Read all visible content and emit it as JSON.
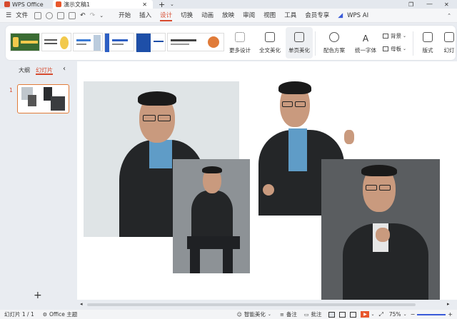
{
  "title_bar": {
    "app_tab": "WPS Office",
    "doc_tab": "演示文稿1",
    "new_tab": "+"
  },
  "menu": {
    "file": "文件",
    "items": [
      "开始",
      "插入",
      "设计",
      "切换",
      "动画",
      "放映",
      "审阅",
      "视图",
      "工具",
      "会员专享"
    ],
    "active": "设计",
    "ai": "WPS AI",
    "accent": "#d64a2e"
  },
  "ribbon": {
    "more_design": "更多设计",
    "full_beautify": "全文美化",
    "single_beautify": "单页美化",
    "color_scheme": "配色方案",
    "unify_font": "统一字体",
    "background": "背景",
    "master": "母板",
    "format": "版式",
    "more": "幻灯"
  },
  "left_panel": {
    "tab_outline": "大纲",
    "tab_slides": "幻灯片",
    "slide_number": "1",
    "add": "+"
  },
  "status": {
    "slide_info": "幻灯片 1 / 1",
    "theme": "Office 主题",
    "smart_beautify": "智能美化",
    "notes": "备注",
    "comments": "批注",
    "zoom": "75%"
  },
  "icons": [
    "menu-icon",
    "save-icon",
    "undo-icon",
    "redo-icon",
    "wps-ai-icon",
    "play-icon",
    "collapse-icon"
  ]
}
